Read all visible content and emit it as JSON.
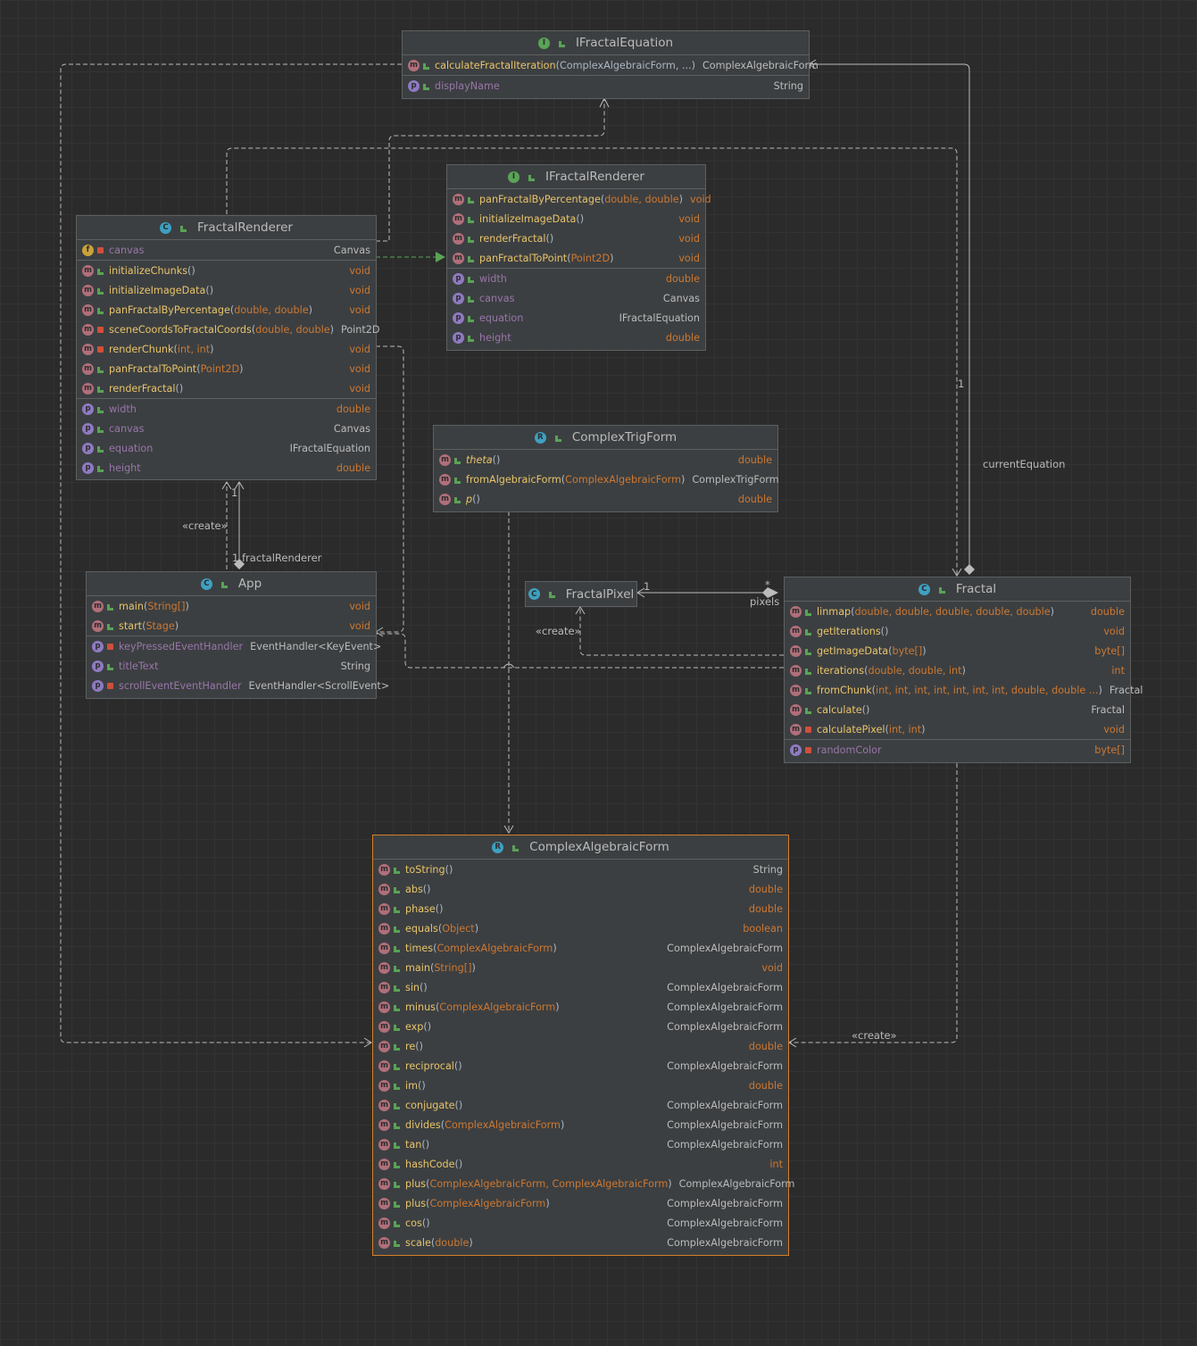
{
  "classes": {
    "ifractal_equation": {
      "kind": "I",
      "name": "IFractalEquation",
      "methods": [
        {
          "name": "calculateFractalIteration",
          "open": "(",
          "params": "ComplexAlgebraicForm, ...",
          "close": ")",
          "type": "ComplexAlgebraicForm"
        }
      ],
      "props": [
        {
          "name": "displayName",
          "type": "String"
        }
      ]
    },
    "ifractal_renderer": {
      "kind": "I",
      "name": "IFractalRenderer",
      "methods": [
        {
          "name": "panFractalByPercentage",
          "open": "(",
          "params": "double, double",
          "close": ")",
          "type": "void"
        },
        {
          "name": "initializeImageData",
          "open": "()",
          "params": "",
          "close": "",
          "type": "void"
        },
        {
          "name": "renderFractal",
          "open": "()",
          "params": "",
          "close": "",
          "type": "void"
        },
        {
          "name": "panFractalToPoint",
          "open": "(",
          "params": "Point2D",
          "close": ")",
          "type": "void"
        }
      ],
      "props": [
        {
          "name": "width",
          "type": "double"
        },
        {
          "name": "canvas",
          "type": "Canvas"
        },
        {
          "name": "equation",
          "type": "IFractalEquation"
        },
        {
          "name": "height",
          "type": "double"
        }
      ]
    },
    "fractal_renderer": {
      "kind": "C",
      "name": "FractalRenderer",
      "fields": [
        {
          "name": "canvas",
          "type": "Canvas"
        }
      ],
      "methods": [
        {
          "name": "initializeChunks",
          "open": "()",
          "params": "",
          "close": "",
          "type": "void"
        },
        {
          "name": "initializeImageData",
          "open": "()",
          "params": "",
          "close": "",
          "type": "void"
        },
        {
          "name": "panFractalByPercentage",
          "open": "(",
          "params": "double, double",
          "close": ")",
          "type": "void"
        },
        {
          "name": "sceneCoordsToFractalCoords",
          "open": "(",
          "params": "double, double",
          "close": ")",
          "type": "Point2D"
        },
        {
          "name": "renderChunk",
          "open": "(",
          "params": "int, int",
          "close": ")",
          "type": "void"
        },
        {
          "name": "panFractalToPoint",
          "open": "(",
          "params": "Point2D",
          "close": ")",
          "type": "void"
        },
        {
          "name": "renderFractal",
          "open": "()",
          "params": "",
          "close": "",
          "type": "void"
        }
      ],
      "props": [
        {
          "name": "width",
          "type": "double"
        },
        {
          "name": "canvas",
          "type": "Canvas"
        },
        {
          "name": "equation",
          "type": "IFractalEquation"
        },
        {
          "name": "height",
          "type": "double"
        }
      ]
    },
    "complex_trig_form": {
      "kind": "R",
      "name": "ComplexTrigForm",
      "methods": [
        {
          "name": "theta",
          "open": "()",
          "params": "",
          "close": "",
          "type": "double"
        },
        {
          "name": "fromAlgebraicForm",
          "open": "(",
          "params": "ComplexAlgebraicForm",
          "close": ")",
          "type": "ComplexTrigForm"
        },
        {
          "name": "p",
          "open": "()",
          "params": "",
          "close": "",
          "type": "double"
        }
      ]
    },
    "app": {
      "kind": "C",
      "name": "App",
      "methods": [
        {
          "name": "main",
          "open": "(",
          "params": "String[]",
          "close": ")",
          "type": "void"
        },
        {
          "name": "start",
          "open": "(",
          "params": "Stage",
          "close": ")",
          "type": "void"
        }
      ],
      "props": [
        {
          "name": "keyPressedEventHandler",
          "type": "EventHandler<KeyEvent>"
        },
        {
          "name": "titleText",
          "type": "String"
        },
        {
          "name": "scrollEventEventHandler",
          "type": "EventHandler<ScrollEvent>"
        }
      ]
    },
    "fractal_pixel": {
      "kind": "C",
      "name": "FractalPixel"
    },
    "fractal": {
      "kind": "C",
      "name": "Fractal",
      "methods": [
        {
          "name": "linmap",
          "open": "(",
          "params": "double, double, double, double, double",
          "close": ")",
          "type": "double"
        },
        {
          "name": "getIterations",
          "open": "()",
          "params": "",
          "close": "",
          "type": "void"
        },
        {
          "name": "getImageData",
          "open": "(",
          "params": "byte[]",
          "close": ")",
          "type": "byte[]"
        },
        {
          "name": "iterations",
          "open": "(",
          "params": "double, double, int",
          "close": ")",
          "type": "int"
        },
        {
          "name": "fromChunk",
          "open": "(",
          "params": "int, int, int, int, int, int, int, double, double ...",
          "close": ")",
          "type": "Fractal"
        },
        {
          "name": "calculate",
          "open": "()",
          "params": "",
          "close": "",
          "type": "Fractal"
        },
        {
          "name": "calculatePixel",
          "open": "(",
          "params": "int, int",
          "close": ")",
          "type": "void"
        }
      ],
      "props": [
        {
          "name": "randomColor",
          "type": "byte[]"
        }
      ]
    },
    "complex_algebraic_form": {
      "kind": "R",
      "name": "ComplexAlgebraicForm",
      "methods": [
        {
          "name": "toString",
          "open": "()",
          "params": "",
          "close": "",
          "type": "String"
        },
        {
          "name": "abs",
          "open": "()",
          "params": "",
          "close": "",
          "type": "double"
        },
        {
          "name": "phase",
          "open": "()",
          "params": "",
          "close": "",
          "type": "double"
        },
        {
          "name": "equals",
          "open": "(",
          "params": "Object",
          "close": ")",
          "type": "boolean"
        },
        {
          "name": "times",
          "open": "(",
          "params": "ComplexAlgebraicForm",
          "close": ")",
          "type": "ComplexAlgebraicForm"
        },
        {
          "name": "main",
          "open": "(",
          "params": "String[]",
          "close": ")",
          "type": "void"
        },
        {
          "name": "sin",
          "open": "()",
          "params": "",
          "close": "",
          "type": "ComplexAlgebraicForm"
        },
        {
          "name": "minus",
          "open": "(",
          "params": "ComplexAlgebraicForm",
          "close": ")",
          "type": "ComplexAlgebraicForm"
        },
        {
          "name": "exp",
          "open": "()",
          "params": "",
          "close": "",
          "type": "ComplexAlgebraicForm"
        },
        {
          "name": "re",
          "open": "()",
          "params": "",
          "close": "",
          "type": "double"
        },
        {
          "name": "reciprocal",
          "open": "()",
          "params": "",
          "close": "",
          "type": "ComplexAlgebraicForm"
        },
        {
          "name": "im",
          "open": "()",
          "params": "",
          "close": "",
          "type": "double"
        },
        {
          "name": "conjugate",
          "open": "()",
          "params": "",
          "close": "",
          "type": "ComplexAlgebraicForm"
        },
        {
          "name": "divides",
          "open": "(",
          "params": "ComplexAlgebraicForm",
          "close": ")",
          "type": "ComplexAlgebraicForm"
        },
        {
          "name": "tan",
          "open": "()",
          "params": "",
          "close": "",
          "type": "ComplexAlgebraicForm"
        },
        {
          "name": "hashCode",
          "open": "()",
          "params": "",
          "close": "",
          "type": "int"
        },
        {
          "name": "plus",
          "open": "(",
          "params": "ComplexAlgebraicForm, ComplexAlgebraicForm",
          "close": ")",
          "type": "ComplexAlgebraicForm"
        },
        {
          "name": "plus",
          "open": "(",
          "params": "ComplexAlgebraicForm",
          "close": ")",
          "type": "ComplexAlgebraicForm"
        },
        {
          "name": "cos",
          "open": "()",
          "params": "",
          "close": "",
          "type": "ComplexAlgebraicForm"
        },
        {
          "name": "scale",
          "open": "(",
          "params": "double",
          "close": ")",
          "type": "ComplexAlgebraicForm"
        }
      ]
    }
  },
  "labels": {
    "create_app": "«create»",
    "mult_renderer_top": "1",
    "mult_renderer_bottom": "1",
    "role_fractal_renderer": "fractalRenderer",
    "role_current_equation": "currentEquation",
    "mult_equation": "1",
    "mult_pixels_one": "1",
    "mult_pixels_many": "*",
    "role_pixels": "pixels",
    "create_pixel": "«create»",
    "create_algebraic": "«create»"
  },
  "colors": {
    "background": "#2b2b2b",
    "node": "#3c3f41",
    "border": "#5e6060",
    "selected_border": "#d4802a",
    "method_name": "#e8c46a",
    "property_name": "#9876aa",
    "keyword_type": "#cc7832",
    "edge": "#bbbbbb",
    "realization": "#5aa357"
  }
}
